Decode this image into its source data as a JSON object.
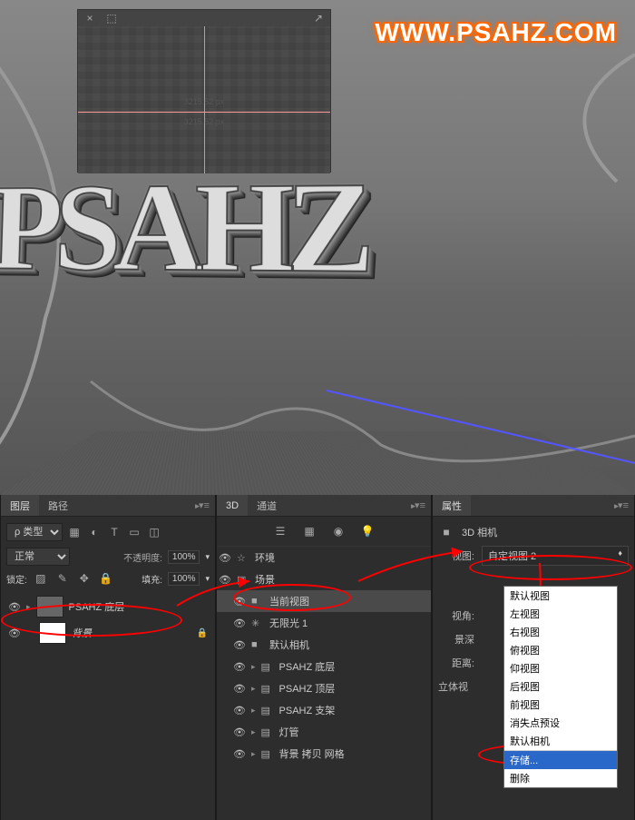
{
  "watermark": "WWW.PSAHZ.COM",
  "viewport": {
    "text3d": "PSAHZ",
    "navigator": {
      "close": "×",
      "expand": "⬚",
      "popout": "↗",
      "label1": "3215.52 px",
      "label2": "3215.52 px"
    }
  },
  "layers_panel": {
    "tab1": "图层",
    "tab2": "路径",
    "kind_label": "ρ 类型",
    "mode": "正常",
    "opacity_label": "不透明度:",
    "opacity_value": "100%",
    "lock_label": "锁定:",
    "fill_label": "填充:",
    "fill_value": "100%",
    "items": [
      {
        "name": "PSAHZ 底层"
      },
      {
        "name": "背景"
      }
    ]
  },
  "scene_panel": {
    "tab1": "3D",
    "tab2": "通道",
    "items": [
      {
        "icon": "☆",
        "name": "环境"
      },
      {
        "icon": "▣",
        "name": "场景"
      },
      {
        "icon": "■",
        "name": "当前视图",
        "active": true
      },
      {
        "icon": "✳",
        "name": "无限光 1"
      },
      {
        "icon": "■",
        "name": "默认相机"
      },
      {
        "icon": "▤",
        "name": "PSAHZ 底层"
      },
      {
        "icon": "▤",
        "name": "PSAHZ 顶层"
      },
      {
        "icon": "▤",
        "name": "PSAHZ 支架"
      },
      {
        "icon": "▤",
        "name": "灯管"
      },
      {
        "icon": "▤",
        "name": "背景 拷贝 网格"
      }
    ]
  },
  "properties_panel": {
    "tab": "属性",
    "header": "3D 相机",
    "view_label": "视图:",
    "view_value": "自定视图 2",
    "fov_label": "视角:",
    "dof_label": "景深",
    "distance_label": "距离:",
    "stereo_label": "立体视",
    "dropdown": [
      "默认视图",
      "左视图",
      "右视图",
      "俯视图",
      "仰视图",
      "后视图",
      "前视图",
      "消失点预设",
      "默认相机",
      "",
      "存储...",
      "删除"
    ]
  }
}
